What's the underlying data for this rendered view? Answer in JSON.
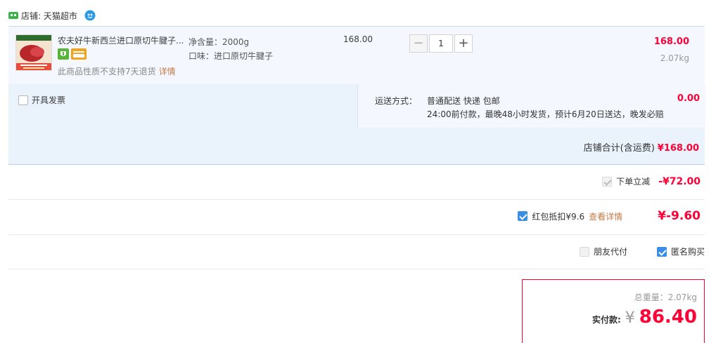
{
  "shop": {
    "label": "店铺: 天猫超市",
    "icons": [
      "tmall-shop-icon",
      "wangwang-chat-icon"
    ]
  },
  "item": {
    "title": "农夫好牛新西兰进口原切牛腱子...",
    "notice": "此商品性质不支持7天退货",
    "notice_link": "详情",
    "spec_weight": "净含量：2000g",
    "spec_flavor": "口味：进口原切牛腱子",
    "unit_price": "168.00",
    "quantity": "1",
    "minus_label": "−",
    "plus_label": "+",
    "line_total": "168.00",
    "weight": "2.07kg"
  },
  "invoice": {
    "label": "开具发票",
    "checked": false
  },
  "shipping": {
    "label": "运送方式：",
    "methods": "普通配送 快递 包邮",
    "note": "24:00前付款，最晚48小时发货，预计6月20日送达，晚发必赔",
    "fee": "0.00"
  },
  "subtotal": {
    "label": "店铺合计(含运费)",
    "value": "¥168.00"
  },
  "discounts": {
    "instant": {
      "label": "下单立减",
      "value": "-¥72.00",
      "checked": true,
      "disabled": true
    },
    "redpacket": {
      "label": "红包抵扣¥9.6",
      "link": "查看详情",
      "value": "¥-9.60",
      "checked": true
    },
    "friend_pay": {
      "label": "朋友代付",
      "checked": false,
      "disabled": true
    },
    "anonymous": {
      "label": "匿名购买",
      "checked": true
    }
  },
  "payment": {
    "weight_label": "总重量：2.07kg",
    "amount_label": "实付款:",
    "currency": "¥",
    "amount": "86.40"
  },
  "colors": {
    "accent_red": "#ff0036",
    "link_brown": "#c47a47",
    "checkbox_blue": "#3a8ee6",
    "panel_blue": "#eaf2fb"
  }
}
